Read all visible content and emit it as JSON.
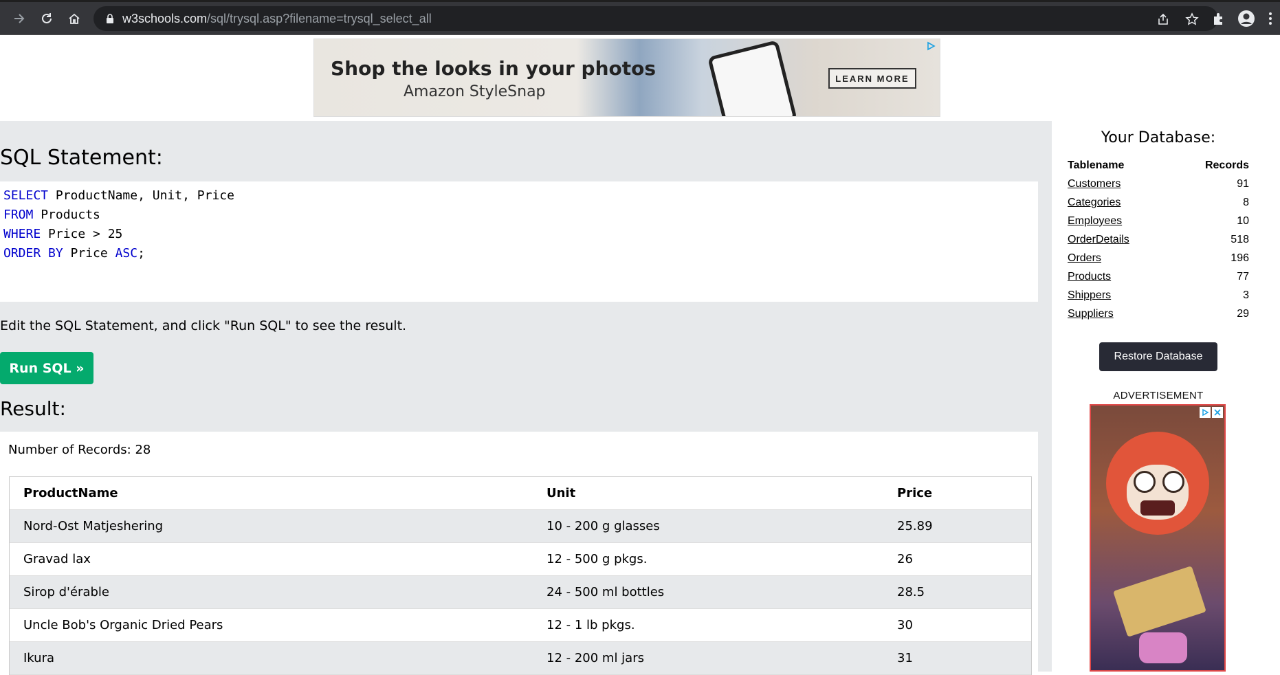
{
  "browser": {
    "url_host": "w3schools.com",
    "url_path": "/sql/trysql.asp?filename=trysql_select_all"
  },
  "top_ad": {
    "headline": "Shop the looks in your photos",
    "subline": "Amazon StyleSnap",
    "cta": "LEARN MORE"
  },
  "editor": {
    "heading": "SQL Statement:",
    "lines": [
      {
        "kw1": "SELECT",
        "rest1": " ProductName, Unit, Price",
        "kw2": "",
        "rest2": ""
      },
      {
        "kw1": "FROM",
        "rest1": " Products",
        "kw2": "",
        "rest2": ""
      },
      {
        "kw1": "WHERE",
        "rest1": " Price > 25",
        "kw2": "",
        "rest2": ""
      },
      {
        "kw1": "ORDER BY",
        "rest1": " Price ",
        "kw2": "ASC",
        "rest2": ";"
      }
    ],
    "instruction": "Edit the SQL Statement, and click \"Run SQL\" to see the result.",
    "run_button": "Run SQL »"
  },
  "result": {
    "heading": "Result:",
    "record_count": "Number of Records: 28",
    "columns": [
      "ProductName",
      "Unit",
      "Price"
    ],
    "rows": [
      [
        "Nord-Ost Matjeshering",
        "10 - 200 g glasses",
        "25.89"
      ],
      [
        "Gravad lax",
        "12 - 500 g pkgs.",
        "26"
      ],
      [
        "Sirop d'érable",
        "24 - 500 ml bottles",
        "28.5"
      ],
      [
        "Uncle Bob's Organic Dried Pears",
        "12 - 1 lb pkgs.",
        "30"
      ],
      [
        "Ikura",
        "12 - 200 ml jars",
        "31"
      ]
    ]
  },
  "database": {
    "title": "Your Database:",
    "col_table": "Tablename",
    "col_records": "Records",
    "tables": [
      {
        "name": "Customers",
        "records": "91"
      },
      {
        "name": "Categories",
        "records": "8"
      },
      {
        "name": "Employees",
        "records": "10"
      },
      {
        "name": "OrderDetails",
        "records": "518"
      },
      {
        "name": "Orders",
        "records": "196"
      },
      {
        "name": "Products",
        "records": "77"
      },
      {
        "name": "Shippers",
        "records": "3"
      },
      {
        "name": "Suppliers",
        "records": "29"
      }
    ],
    "restore_button": "Restore Database",
    "ad_label": "ADVERTISEMENT"
  },
  "colors": {
    "run_button": "#04aa6d",
    "restore_button": "#282a35",
    "keyword": "#0000cd",
    "panel_bg": "#e7e9eb"
  }
}
